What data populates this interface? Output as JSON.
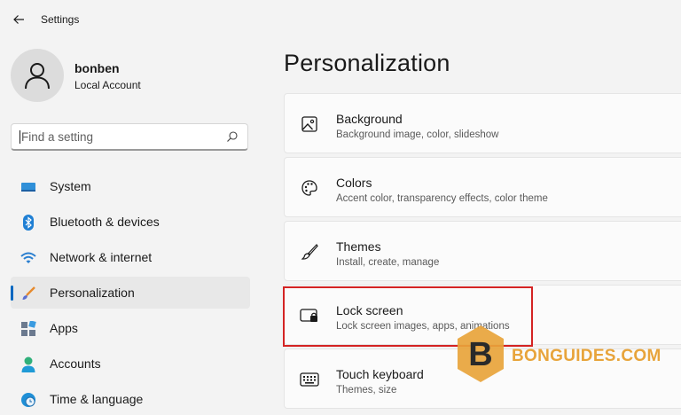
{
  "window": {
    "title": "Settings"
  },
  "profile": {
    "name": "bonben",
    "account_type": "Local Account"
  },
  "search": {
    "placeholder": "Find a setting",
    "value": ""
  },
  "sidebar": {
    "items": [
      {
        "label": "System",
        "icon": "system-icon",
        "active": false
      },
      {
        "label": "Bluetooth & devices",
        "icon": "bluetooth-icon",
        "active": false
      },
      {
        "label": "Network & internet",
        "icon": "wifi-icon",
        "active": false
      },
      {
        "label": "Personalization",
        "icon": "brush-icon",
        "active": true
      },
      {
        "label": "Apps",
        "icon": "apps-icon",
        "active": false
      },
      {
        "label": "Accounts",
        "icon": "accounts-icon",
        "active": false
      },
      {
        "label": "Time & language",
        "icon": "globe-clock-icon",
        "active": false
      }
    ]
  },
  "main": {
    "title": "Personalization",
    "cards": [
      {
        "title": "Background",
        "subtitle": "Background image, color, slideshow",
        "icon": "picture-icon"
      },
      {
        "title": "Colors",
        "subtitle": "Accent color, transparency effects, color theme",
        "icon": "palette-icon"
      },
      {
        "title": "Themes",
        "subtitle": "Install, create, manage",
        "icon": "paintbrush-icon"
      },
      {
        "title": "Lock screen",
        "subtitle": "Lock screen images, apps, animations",
        "icon": "lock-screen-icon"
      },
      {
        "title": "Touch keyboard",
        "subtitle": "Themes, size",
        "icon": "keyboard-icon"
      }
    ]
  },
  "watermark": {
    "badge_letter": "B",
    "text": "BONGUIDES.COM"
  },
  "colors": {
    "accent": "#0067c0",
    "highlight": "#d42323",
    "watermark": "#e8a43b"
  }
}
